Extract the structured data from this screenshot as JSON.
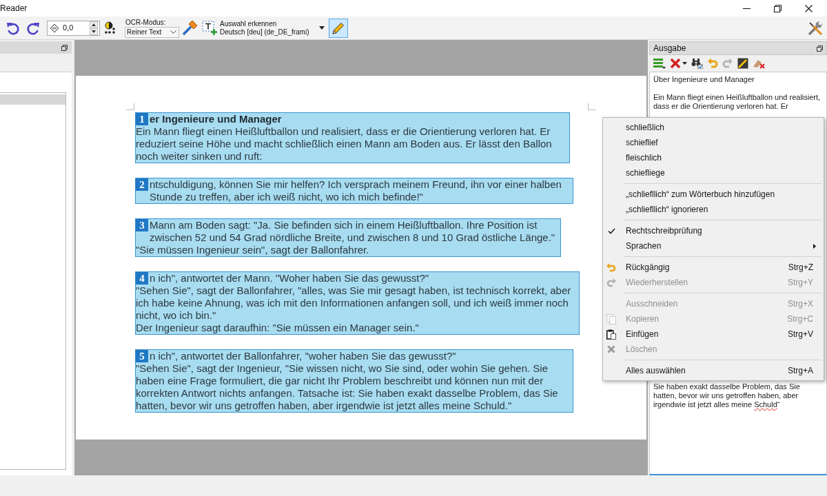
{
  "window": {
    "title": "Reader"
  },
  "toolbar": {
    "angle_value": "0,0",
    "ocr_mode": {
      "label": "OCR-Modus:",
      "value": "Reiner Text"
    },
    "recognize": {
      "action": "Auswahl erkennen",
      "language": "Deutsch [deu] (de_DE_frami)"
    },
    "edit_mode": {
      "on": true
    }
  },
  "left_panel": {
    "items": [
      {
        "selected": true
      }
    ]
  },
  "document": {
    "blocks": [
      {
        "number": "1",
        "paragraphs": [
          {
            "kind": "heading",
            "text": "er Ingenieure und Manager"
          },
          {
            "kind": "body",
            "text": "Ein Mann fliegt einen Heißluftballon und realisiert, dass er die Orientierung verloren hat. Er reduziert seine Höhe und macht schließlich einen Mann am Boden aus. Er lässt den Ballon noch weiter sinken und ruft:"
          }
        ]
      },
      {
        "number": "2",
        "paragraphs": [
          {
            "kind": "body",
            "text": "ntschuldigung, können Sie mir helfen? Ich versprach meinem Freund, ihn vor einer halben Stunde zu treffen, aber ich weiß nicht, wo ich mich befinde!\""
          }
        ]
      },
      {
        "number": "3",
        "paragraphs": [
          {
            "kind": "body",
            "text": "Mann am Boden sagt: \"Ja. Sie befinden sich in einem Heißluftballon. Ihre Position ist zwischen 52 und 54 Grad nördliche Breite, und zwischen 8 und 10 Grad östliche Länge.\""
          },
          {
            "kind": "body",
            "text": "\"Sie müssen Ingenieur sein\", sagt der Ballonfahrer."
          }
        ]
      },
      {
        "number": "4",
        "paragraphs": [
          {
            "kind": "body",
            "text": "n ich\", antwortet der Mann. \"Woher haben Sie das gewusst?\""
          },
          {
            "kind": "body",
            "text": "\"Sehen Sie\", sagt der Ballonfahrer, \"alles, was Sie mir gesagt haben, ist technisch korrekt, aber ich habe keine Ahnung, was ich mit den Informationen anfangen soll, und ich weiß immer noch nicht, wo ich bin.\""
          },
          {
            "kind": "body",
            "text": "Der Ingenieur sagt daraufhin: \"Sie müssen ein Manager sein.\""
          }
        ]
      },
      {
        "number": "5",
        "paragraphs": [
          {
            "kind": "body",
            "text": "n ich\", antwortet der Ballonfahrer, \"woher haben Sie das gewusst?\""
          },
          {
            "kind": "body",
            "text": "\"Sehen Sie\", sagt der Ingenieur, \"Sie wissen nicht, wo Sie sind, oder wohin Sie gehen. Sie haben eine Frage formuliert, die gar nicht Ihr Problem beschreibt und können nun mit der korrekten Antwort nichts anfangen. Tatsache ist: Sie haben exakt dasselbe Problem, das Sie hatten, bevor wir uns getroffen haben, aber irgendwie ist jetzt alles meine Schuld.\""
          }
        ]
      }
    ]
  },
  "output_panel": {
    "title": "Ausgabe",
    "heading": "Über Ingenieure und Manager",
    "intro": "Ein Mann fliegt einen Heißluftballon und realisiert, dass er die Orientierung verloren hat. Er",
    "ending": [
      {
        "text": "Sie haben exakt dasselbe Problem, das Sie hatten, bevor wir uns getroffen haben, aber irgendwie ist jetzt alles meine ",
        "misspelled": false
      },
      {
        "text": "Schuld",
        "misspelled": true
      },
      {
        "text": "“"
      }
    ]
  },
  "context_menu": {
    "sections": [
      {
        "items": [
          {
            "label": "schließlich",
            "disabled": false,
            "checked": false
          },
          {
            "label": "schieflief",
            "disabled": false,
            "checked": false
          },
          {
            "label": "fleischlich",
            "disabled": false,
            "checked": false
          },
          {
            "label": "schiefliege",
            "disabled": false,
            "checked": false
          }
        ]
      },
      {
        "items": [
          {
            "label": "„schliefllich“ zum Wörterbuch hinzufügen",
            "disabled": false,
            "checked": false
          },
          {
            "label": "„schliefllich“ ignorieren",
            "disabled": false,
            "checked": false
          }
        ]
      },
      {
        "items": [
          {
            "label": "Rechtschreibprüfung",
            "disabled": false,
            "checked": true
          },
          {
            "label": "Sprachen",
            "disabled": false,
            "checked": false,
            "submenu": true
          }
        ]
      },
      {
        "items": [
          {
            "label": "Rückgängig",
            "shortcut": "Strg+Z",
            "disabled": false,
            "checked": false
          },
          {
            "label": "Wiederherstellen",
            "shortcut": "Strg+Y",
            "disabled": true,
            "checked": false
          }
        ]
      },
      {
        "items": [
          {
            "label": "Ausschneiden",
            "shortcut": "Strg+X",
            "disabled": true,
            "checked": false
          },
          {
            "label": "Kopieren",
            "shortcut": "Strg+C",
            "disabled": true,
            "checked": false
          },
          {
            "label": "Einfügen",
            "shortcut": "Strg+V",
            "disabled": false,
            "checked": false
          },
          {
            "label": "Löschen",
            "disabled": true,
            "checked": false
          }
        ]
      },
      {
        "items": [
          {
            "label": "Alles auswählen",
            "shortcut": "Strg+A",
            "disabled": false,
            "checked": false
          }
        ]
      }
    ]
  }
}
